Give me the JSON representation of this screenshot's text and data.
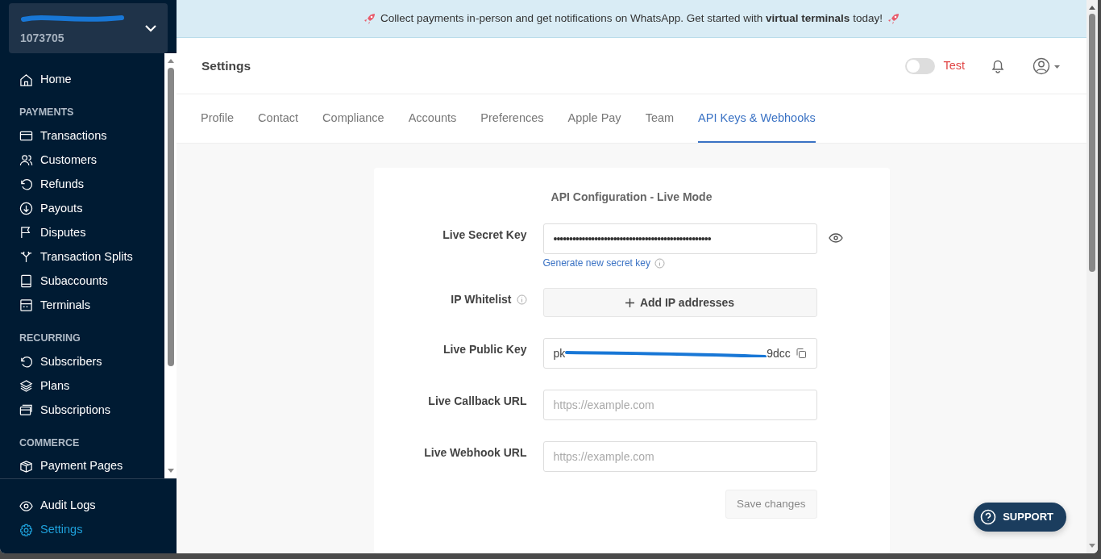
{
  "account": {
    "id": "1073705"
  },
  "sidebar": {
    "top_items": [
      {
        "label": "Home",
        "selected": false
      }
    ],
    "sections": [
      {
        "title": "PAYMENTS",
        "items": [
          {
            "label": "Transactions",
            "selected": false
          },
          {
            "label": "Customers",
            "selected": false
          },
          {
            "label": "Refunds",
            "selected": false
          },
          {
            "label": "Payouts",
            "selected": false
          },
          {
            "label": "Disputes",
            "selected": false
          },
          {
            "label": "Transaction Splits",
            "selected": false
          },
          {
            "label": "Subaccounts",
            "selected": false
          },
          {
            "label": "Terminals",
            "selected": false
          }
        ]
      },
      {
        "title": "RECURRING",
        "items": [
          {
            "label": "Subscribers",
            "selected": false
          },
          {
            "label": "Plans",
            "selected": false
          },
          {
            "label": "Subscriptions",
            "selected": false
          }
        ]
      },
      {
        "title": "COMMERCE",
        "items": [
          {
            "label": "Payment Pages",
            "selected": false
          }
        ]
      }
    ],
    "bottom_items": [
      {
        "label": "Audit Logs",
        "selected": false
      },
      {
        "label": "Settings",
        "selected": true
      }
    ]
  },
  "banner": {
    "text": "Collect payments in-person and get notifications on WhatsApp. Get started with **virtual terminals** today!"
  },
  "header": {
    "title": "Settings",
    "test_mode": {
      "label": "Test",
      "on": false
    }
  },
  "tabs": [
    {
      "label": "Profile",
      "selected": false
    },
    {
      "label": "Contact",
      "selected": false
    },
    {
      "label": "Compliance",
      "selected": false
    },
    {
      "label": "Accounts",
      "selected": false
    },
    {
      "label": "Preferences",
      "selected": false
    },
    {
      "label": "Apple Pay",
      "selected": false
    },
    {
      "label": "Team",
      "selected": false
    },
    {
      "label": "API Keys & Webhooks",
      "selected": true
    }
  ],
  "form": {
    "title": "API Configuration - Live Mode",
    "fields": [
      {
        "kind": "secret",
        "label": "Live Secret Key",
        "value": "••••••••••••••••••••••••••••••••••••••••••••••••••",
        "link": "Generate new secret key"
      },
      {
        "kind": "add",
        "label": "IP Whitelist",
        "button": "Add IP addresses"
      },
      {
        "kind": "public",
        "label": "Live Public Key",
        "value_start": "pk",
        "value_end": "9dcc"
      },
      {
        "kind": "text",
        "label": "Live Callback URL",
        "placeholder": "https://example.com"
      },
      {
        "kind": "text",
        "label": "Live Webhook URL",
        "placeholder": "https://example.com"
      }
    ],
    "save": {
      "label": "Save changes",
      "disabled": true
    }
  },
  "support": {
    "label": "SUPPORT"
  }
}
